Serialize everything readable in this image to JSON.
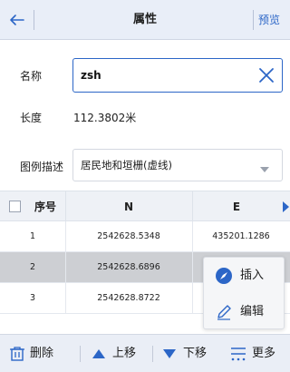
{
  "header": {
    "back_icon": "back-arrow-icon",
    "title": "属性",
    "preview_label": "预览"
  },
  "form": {
    "name_label": "名称",
    "name_value": "zsh",
    "clear_icon": "close-icon",
    "length_label": "长度",
    "length_value": "112.3802米",
    "legend_label": "图例描述",
    "legend_value": "居民地和垣栅(虚线)",
    "dropdown_icon": "chevron-down-icon"
  },
  "table": {
    "columns": [
      "序号",
      "N",
      "E"
    ],
    "rows": [
      {
        "index": "1",
        "n": "2542628.5348",
        "e": "435201.1286"
      },
      {
        "index": "2",
        "n": "2542628.6896",
        "e": ""
      },
      {
        "index": "3",
        "n": "2542628.8722",
        "e": ""
      }
    ],
    "selected_row": 2
  },
  "context_menu": {
    "items": [
      {
        "label": "插入",
        "icon": "navigate-compass-icon"
      },
      {
        "label": "编辑",
        "icon": "pencil-icon"
      }
    ]
  },
  "toolbar": {
    "delete_label": "删除",
    "up_label": "上移",
    "down_label": "下移",
    "more_label": "更多"
  },
  "colors": {
    "accent": "#2c66c7",
    "header_bg": "#e9eef8",
    "selected_row_bg": "#cdcfd3"
  }
}
